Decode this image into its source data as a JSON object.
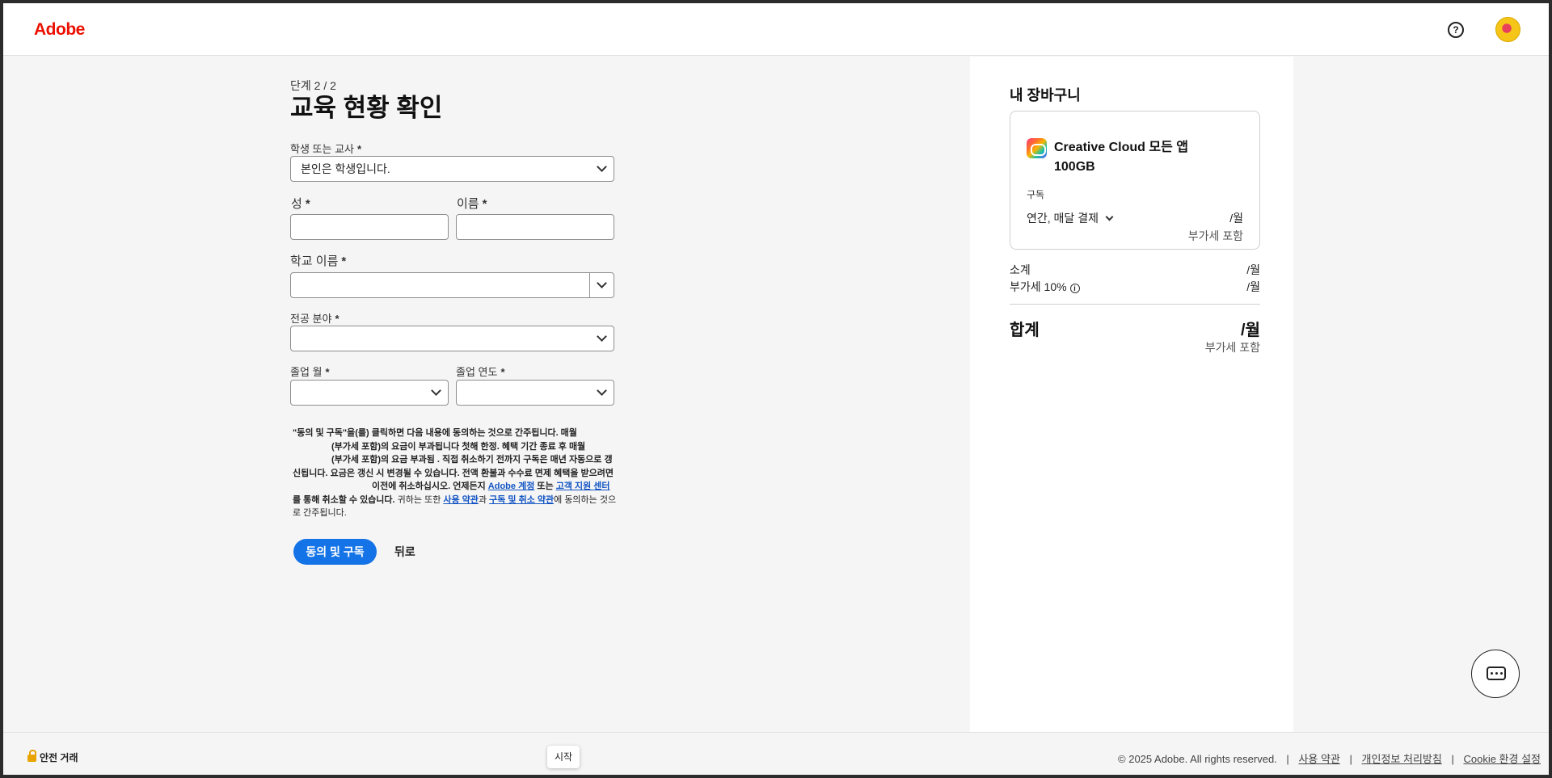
{
  "header": {
    "logo": "Adobe",
    "help_icon": "?"
  },
  "form": {
    "step": "단계 2 / 2",
    "title": "교육 현황 확인",
    "role": {
      "label": "학생 또는 교사",
      "value": "본인은 학생입니다."
    },
    "last_name": {
      "label": "성",
      "value": ""
    },
    "first_name": {
      "label": "이름",
      "value": ""
    },
    "school": {
      "label": "학교 이름",
      "value": ""
    },
    "major": {
      "label": "전공 분야",
      "value": ""
    },
    "grad_month": {
      "label": "졸업 월",
      "value": ""
    },
    "grad_year": {
      "label": "졸업 연도",
      "value": ""
    },
    "required_mark": "*",
    "legal": {
      "p1": "\"동의 및 구독\"을(를) 클릭하면 다음 내용에 동의하는 것으로 간주됩니다. 매월",
      "p2": "(부가세 포함)의 요금이 부과됩니다 첫해 한정. 혜택 기간 종료 후 매월",
      "p3": "(부가세 포함)의 요금 부과됨 . 직접 취소하기 전까지 구독은 매년 자동으로 갱신됩니다. 요금은 갱신 시 변경될 수 있습니다. 전액 환불과 수수료 면제 혜택을 받으려면",
      "p4": "이전에 취소하십시오. 언제든지",
      "link_account": "Adobe 계정",
      "p5": "또는",
      "link_support": "고객 지원 센터",
      "p6": "를 통해 취소할 수 있습니다.",
      "p7": "귀하는 또한",
      "link_terms": "사용 약관",
      "p8": "과",
      "link_cancel": "구독 및 취소 약관",
      "p9": "에 동의하는 것으로 간주됩니다."
    },
    "submit": "동의 및 구독",
    "back": "뒤로"
  },
  "cart": {
    "title": "내 장바구니",
    "product": "Creative Cloud 모든 앱 100GB",
    "subscription_label": "구독",
    "plan": "연간, 매달 결제",
    "per_month": "/월",
    "vat_included": "부가세 포함",
    "subtotal_label": "소계",
    "subtotal_value": "/월",
    "vat_label": "부가세 10%",
    "vat_value": "/월",
    "total_label": "합계",
    "total_value": "/월",
    "total_vat_note": "부가세 포함"
  },
  "footer": {
    "secure": "안전 거래",
    "start_tooltip": "시작",
    "copyright": "© 2025 Adobe. All rights reserved.",
    "links": [
      "사용 약관",
      "개인정보 처리방침",
      "Cookie 환경 설정"
    ],
    "separator": "|"
  },
  "colors": {
    "accent": "#1473e6",
    "adobe_red": "#eb1000",
    "link": "#1355c4"
  }
}
